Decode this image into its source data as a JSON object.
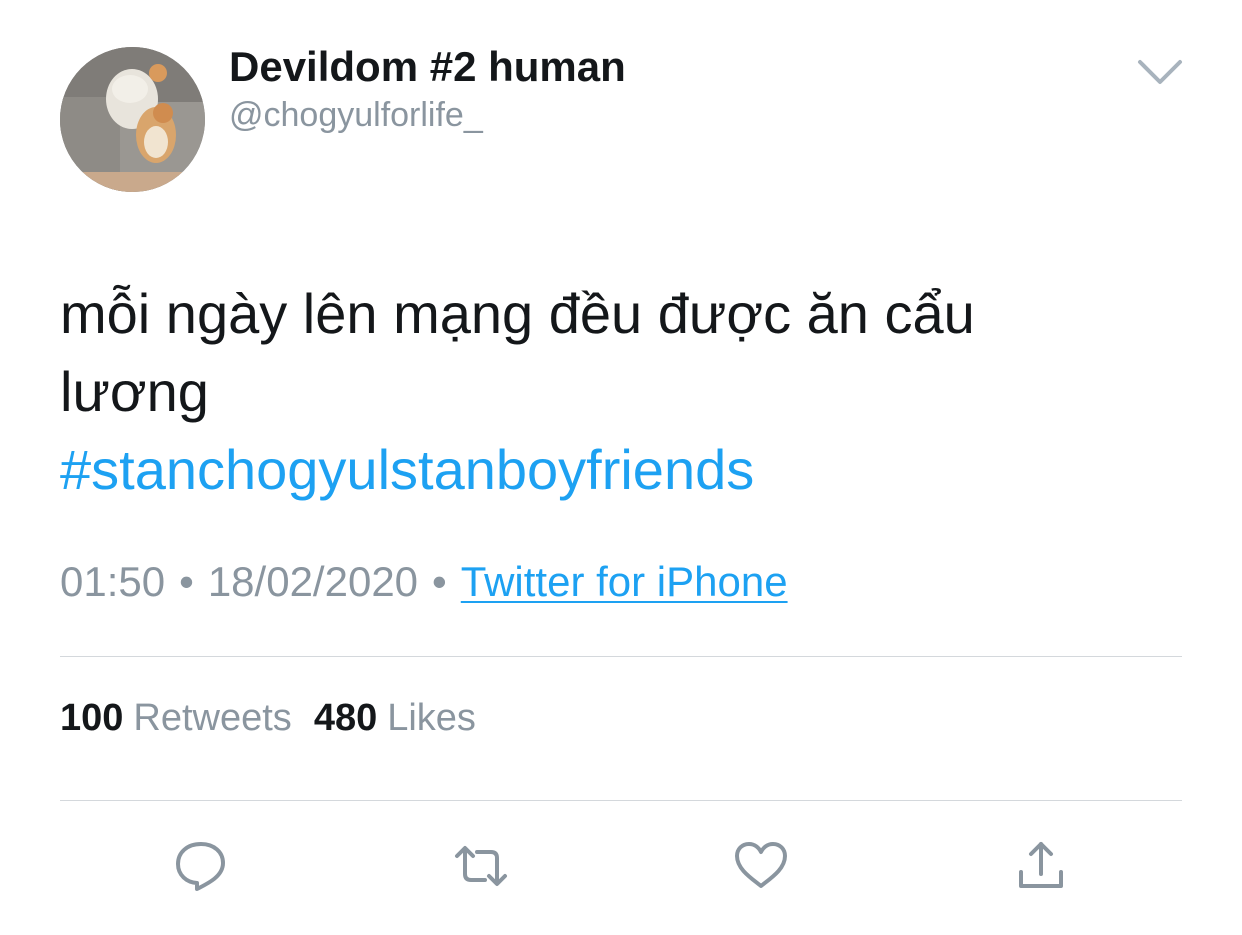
{
  "user": {
    "display_name": "Devildom #2 human",
    "handle": "@chogyulforlife_",
    "avatar_icon": "cat-photo-avatar"
  },
  "menu": {
    "icon": "chevron-down-icon"
  },
  "tweet": {
    "text_line_1": "mỗi ngày lên mạng đều được ăn cẩu",
    "text_line_2": "lương",
    "hashtag": "#stanchogyulstanboyfriends"
  },
  "meta": {
    "time": "01:50",
    "separator": "•",
    "date": "18/02/2020",
    "source": "Twitter for iPhone"
  },
  "stats": {
    "retweets_count": "100",
    "retweets_label": "Retweets",
    "likes_count": "480",
    "likes_label": "Likes"
  },
  "actions": {
    "reply_icon": "reply-icon",
    "retweet_icon": "retweet-icon",
    "like_icon": "heart-icon",
    "share_icon": "share-icon"
  },
  "colors": {
    "link": "#1da1f2",
    "secondary_text": "#8a959f",
    "primary_text": "#14171a",
    "divider": "#d4d8dc"
  }
}
